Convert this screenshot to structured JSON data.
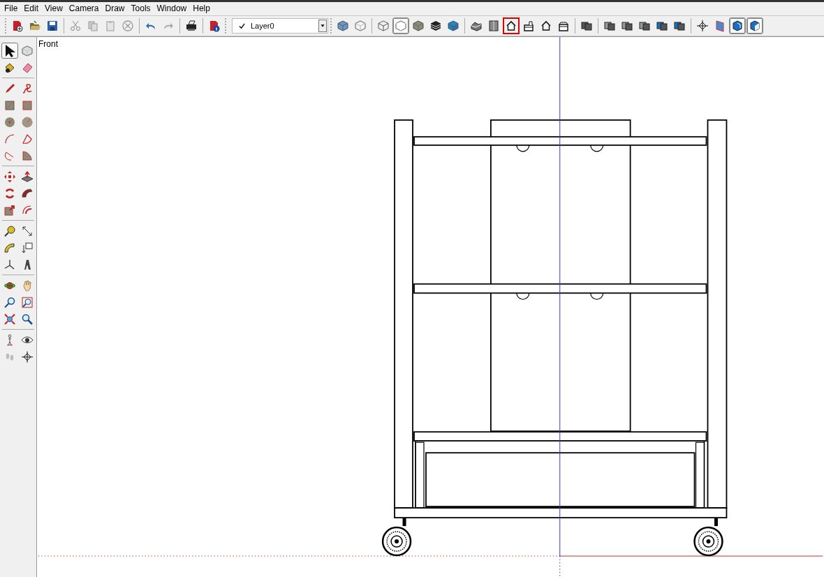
{
  "menu_bar": [
    "File",
    "Edit",
    "View",
    "Camera",
    "Draw",
    "Tools",
    "Window",
    "Help"
  ],
  "toolbar": {
    "groups_before_layer": [
      [
        {
          "kind": "new",
          "selected": false,
          "highlighted": false
        },
        {
          "kind": "open",
          "selected": false,
          "highlighted": false
        },
        {
          "kind": "save",
          "selected": false,
          "highlighted": false
        }
      ],
      [
        {
          "kind": "cut",
          "selected": false,
          "highlighted": false
        },
        {
          "kind": "copy",
          "selected": false,
          "highlighted": false
        },
        {
          "kind": "paste",
          "selected": false,
          "highlighted": false
        },
        {
          "kind": "erase",
          "selected": false,
          "highlighted": false
        }
      ],
      [
        {
          "kind": "undo",
          "selected": false,
          "highlighted": false
        },
        {
          "kind": "redo",
          "selected": false,
          "highlighted": false
        }
      ],
      [
        {
          "kind": "print",
          "selected": false,
          "highlighted": false
        }
      ],
      [
        {
          "kind": "info",
          "selected": false,
          "highlighted": false
        }
      ]
    ],
    "layer": {
      "value": "Layer0"
    },
    "groups_after_layer": [
      [
        {
          "kind": "xray",
          "selected": false,
          "highlighted": false
        },
        {
          "kind": "backedges",
          "selected": false,
          "highlighted": false
        }
      ],
      [
        {
          "kind": "wireframe",
          "selected": false,
          "highlighted": false
        },
        {
          "kind": "hiddenline",
          "selected": true,
          "highlighted": false
        },
        {
          "kind": "shaded",
          "selected": false,
          "highlighted": false
        },
        {
          "kind": "textured",
          "selected": false,
          "highlighted": false
        },
        {
          "kind": "monochrome",
          "selected": false,
          "highlighted": false
        }
      ],
      [
        {
          "kind": "iso",
          "selected": false,
          "highlighted": false
        },
        {
          "kind": "top",
          "selected": false,
          "highlighted": false
        },
        {
          "kind": "front",
          "selected": false,
          "highlighted": true
        },
        {
          "kind": "right",
          "selected": false,
          "highlighted": false
        },
        {
          "kind": "back",
          "selected": false,
          "highlighted": false
        },
        {
          "kind": "left",
          "selected": false,
          "highlighted": false
        }
      ],
      [
        {
          "kind": "union",
          "selected": false,
          "highlighted": false
        }
      ],
      [
        {
          "kind": "boolean",
          "selected": false,
          "highlighted": false
        },
        {
          "kind": "boolean",
          "selected": false,
          "highlighted": false
        },
        {
          "kind": "boolean",
          "selected": false,
          "highlighted": false
        },
        {
          "kind": "booleanblue",
          "selected": false,
          "highlighted": false
        },
        {
          "kind": "booleanblue",
          "selected": false,
          "highlighted": false
        }
      ],
      [
        {
          "kind": "position",
          "selected": false,
          "highlighted": false
        },
        {
          "kind": "section",
          "selected": false,
          "highlighted": false
        },
        {
          "kind": "sectioncut",
          "selected": true,
          "highlighted": false
        },
        {
          "kind": "sectionfill",
          "selected": true,
          "highlighted": false
        }
      ]
    ]
  },
  "tool_palette": [
    [
      {
        "kind": "select",
        "selected": true
      },
      {
        "kind": "component",
        "selected": false
      },
      {
        "kind": "paint",
        "selected": false
      },
      {
        "kind": "eraser",
        "selected": false
      }
    ],
    [
      {
        "kind": "pencil",
        "selected": false
      },
      {
        "kind": "freehand",
        "selected": false
      },
      {
        "kind": "rect",
        "selected": false
      },
      {
        "kind": "rotrect",
        "selected": false
      },
      {
        "kind": "circle",
        "selected": false
      },
      {
        "kind": "polygon",
        "selected": false
      },
      {
        "kind": "arc",
        "selected": false
      },
      {
        "kind": "pie",
        "selected": false
      },
      {
        "kind": "arc3",
        "selected": false
      },
      {
        "kind": "pie2",
        "selected": false
      }
    ],
    [
      {
        "kind": "move",
        "selected": false
      },
      {
        "kind": "pushpull",
        "selected": false
      },
      {
        "kind": "rotate",
        "selected": false
      },
      {
        "kind": "followme",
        "selected": false
      },
      {
        "kind": "scale",
        "selected": false
      },
      {
        "kind": "offset",
        "selected": false
      }
    ],
    [
      {
        "kind": "tape",
        "selected": false
      },
      {
        "kind": "dimension",
        "selected": false
      },
      {
        "kind": "protractor",
        "selected": false
      },
      {
        "kind": "text",
        "selected": false
      },
      {
        "kind": "axes",
        "selected": false
      },
      {
        "kind": "text3d",
        "selected": false
      }
    ],
    [
      {
        "kind": "orbit",
        "selected": false
      },
      {
        "kind": "pan",
        "selected": false
      },
      {
        "kind": "zoom",
        "selected": false
      },
      {
        "kind": "zoomwindow",
        "selected": false
      },
      {
        "kind": "zoomextents",
        "selected": false
      },
      {
        "kind": "prevview",
        "selected": false
      }
    ],
    [
      {
        "kind": "walk",
        "selected": false
      },
      {
        "kind": "look",
        "selected": false
      },
      {
        "kind": "footprints",
        "selected": false
      },
      {
        "kind": "poscam",
        "selected": false
      }
    ]
  ],
  "viewport": {
    "view_label": "Front"
  }
}
